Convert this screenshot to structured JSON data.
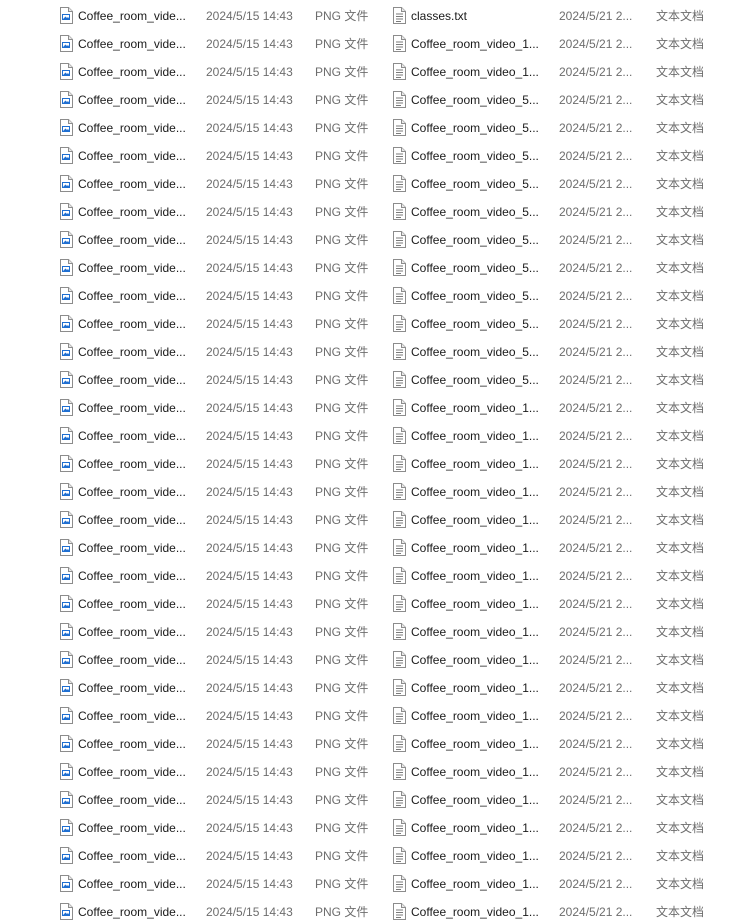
{
  "left_pane": {
    "rows": [
      {
        "name": "Coffee_room_vide...",
        "date": "2024/5/15 14:43",
        "type": "PNG 文件",
        "icon": "png-image-file-icon"
      },
      {
        "name": "Coffee_room_vide...",
        "date": "2024/5/15 14:43",
        "type": "PNG 文件",
        "icon": "png-image-file-icon"
      },
      {
        "name": "Coffee_room_vide...",
        "date": "2024/5/15 14:43",
        "type": "PNG 文件",
        "icon": "png-image-file-icon"
      },
      {
        "name": "Coffee_room_vide...",
        "date": "2024/5/15 14:43",
        "type": "PNG 文件",
        "icon": "png-image-file-icon"
      },
      {
        "name": "Coffee_room_vide...",
        "date": "2024/5/15 14:43",
        "type": "PNG 文件",
        "icon": "png-image-file-icon"
      },
      {
        "name": "Coffee_room_vide...",
        "date": "2024/5/15 14:43",
        "type": "PNG 文件",
        "icon": "png-image-file-icon"
      },
      {
        "name": "Coffee_room_vide...",
        "date": "2024/5/15 14:43",
        "type": "PNG 文件",
        "icon": "png-image-file-icon"
      },
      {
        "name": "Coffee_room_vide...",
        "date": "2024/5/15 14:43",
        "type": "PNG 文件",
        "icon": "png-image-file-icon"
      },
      {
        "name": "Coffee_room_vide...",
        "date": "2024/5/15 14:43",
        "type": "PNG 文件",
        "icon": "png-image-file-icon"
      },
      {
        "name": "Coffee_room_vide...",
        "date": "2024/5/15 14:43",
        "type": "PNG 文件",
        "icon": "png-image-file-icon"
      },
      {
        "name": "Coffee_room_vide...",
        "date": "2024/5/15 14:43",
        "type": "PNG 文件",
        "icon": "png-image-file-icon"
      },
      {
        "name": "Coffee_room_vide...",
        "date": "2024/5/15 14:43",
        "type": "PNG 文件",
        "icon": "png-image-file-icon"
      },
      {
        "name": "Coffee_room_vide...",
        "date": "2024/5/15 14:43",
        "type": "PNG 文件",
        "icon": "png-image-file-icon"
      },
      {
        "name": "Coffee_room_vide...",
        "date": "2024/5/15 14:43",
        "type": "PNG 文件",
        "icon": "png-image-file-icon"
      },
      {
        "name": "Coffee_room_vide...",
        "date": "2024/5/15 14:43",
        "type": "PNG 文件",
        "icon": "png-image-file-icon"
      },
      {
        "name": "Coffee_room_vide...",
        "date": "2024/5/15 14:43",
        "type": "PNG 文件",
        "icon": "png-image-file-icon"
      },
      {
        "name": "Coffee_room_vide...",
        "date": "2024/5/15 14:43",
        "type": "PNG 文件",
        "icon": "png-image-file-icon"
      },
      {
        "name": "Coffee_room_vide...",
        "date": "2024/5/15 14:43",
        "type": "PNG 文件",
        "icon": "png-image-file-icon"
      },
      {
        "name": "Coffee_room_vide...",
        "date": "2024/5/15 14:43",
        "type": "PNG 文件",
        "icon": "png-image-file-icon"
      },
      {
        "name": "Coffee_room_vide...",
        "date": "2024/5/15 14:43",
        "type": "PNG 文件",
        "icon": "png-image-file-icon"
      },
      {
        "name": "Coffee_room_vide...",
        "date": "2024/5/15 14:43",
        "type": "PNG 文件",
        "icon": "png-image-file-icon"
      },
      {
        "name": "Coffee_room_vide...",
        "date": "2024/5/15 14:43",
        "type": "PNG 文件",
        "icon": "png-image-file-icon"
      },
      {
        "name": "Coffee_room_vide...",
        "date": "2024/5/15 14:43",
        "type": "PNG 文件",
        "icon": "png-image-file-icon"
      },
      {
        "name": "Coffee_room_vide...",
        "date": "2024/5/15 14:43",
        "type": "PNG 文件",
        "icon": "png-image-file-icon"
      },
      {
        "name": "Coffee_room_vide...",
        "date": "2024/5/15 14:43",
        "type": "PNG 文件",
        "icon": "png-image-file-icon"
      },
      {
        "name": "Coffee_room_vide...",
        "date": "2024/5/15 14:43",
        "type": "PNG 文件",
        "icon": "png-image-file-icon"
      },
      {
        "name": "Coffee_room_vide...",
        "date": "2024/5/15 14:43",
        "type": "PNG 文件",
        "icon": "png-image-file-icon"
      },
      {
        "name": "Coffee_room_vide...",
        "date": "2024/5/15 14:43",
        "type": "PNG 文件",
        "icon": "png-image-file-icon"
      },
      {
        "name": "Coffee_room_vide...",
        "date": "2024/5/15 14:43",
        "type": "PNG 文件",
        "icon": "png-image-file-icon"
      },
      {
        "name": "Coffee_room_vide...",
        "date": "2024/5/15 14:43",
        "type": "PNG 文件",
        "icon": "png-image-file-icon"
      },
      {
        "name": "Coffee_room_vide...",
        "date": "2024/5/15 14:43",
        "type": "PNG 文件",
        "icon": "png-image-file-icon"
      },
      {
        "name": "Coffee_room_vide...",
        "date": "2024/5/15 14:43",
        "type": "PNG 文件",
        "icon": "png-image-file-icon"
      },
      {
        "name": "Coffee_room_vide...",
        "date": "2024/5/15 14:43",
        "type": "PNG 文件",
        "icon": "png-image-file-icon"
      }
    ]
  },
  "right_pane": {
    "rows": [
      {
        "name": "classes.txt",
        "date": "2024/5/21 2...",
        "type": "文本文档",
        "icon": "text-document-icon"
      },
      {
        "name": "Coffee_room_video_1...",
        "date": "2024/5/21 2...",
        "type": "文本文档",
        "icon": "text-document-icon"
      },
      {
        "name": "Coffee_room_video_1...",
        "date": "2024/5/21 2...",
        "type": "文本文档",
        "icon": "text-document-icon"
      },
      {
        "name": "Coffee_room_video_5...",
        "date": "2024/5/21 2...",
        "type": "文本文档",
        "icon": "text-document-icon"
      },
      {
        "name": "Coffee_room_video_5...",
        "date": "2024/5/21 2...",
        "type": "文本文档",
        "icon": "text-document-icon"
      },
      {
        "name": "Coffee_room_video_5...",
        "date": "2024/5/21 2...",
        "type": "文本文档",
        "icon": "text-document-icon"
      },
      {
        "name": "Coffee_room_video_5...",
        "date": "2024/5/21 2...",
        "type": "文本文档",
        "icon": "text-document-icon"
      },
      {
        "name": "Coffee_room_video_5...",
        "date": "2024/5/21 2...",
        "type": "文本文档",
        "icon": "text-document-icon"
      },
      {
        "name": "Coffee_room_video_5...",
        "date": "2024/5/21 2...",
        "type": "文本文档",
        "icon": "text-document-icon"
      },
      {
        "name": "Coffee_room_video_5...",
        "date": "2024/5/21 2...",
        "type": "文本文档",
        "icon": "text-document-icon"
      },
      {
        "name": "Coffee_room_video_5...",
        "date": "2024/5/21 2...",
        "type": "文本文档",
        "icon": "text-document-icon"
      },
      {
        "name": "Coffee_room_video_5...",
        "date": "2024/5/21 2...",
        "type": "文本文档",
        "icon": "text-document-icon"
      },
      {
        "name": "Coffee_room_video_5...",
        "date": "2024/5/21 2...",
        "type": "文本文档",
        "icon": "text-document-icon"
      },
      {
        "name": "Coffee_room_video_5...",
        "date": "2024/5/21 2...",
        "type": "文本文档",
        "icon": "text-document-icon"
      },
      {
        "name": "Coffee_room_video_1...",
        "date": "2024/5/21 2...",
        "type": "文本文档",
        "icon": "text-document-icon"
      },
      {
        "name": "Coffee_room_video_1...",
        "date": "2024/5/21 2...",
        "type": "文本文档",
        "icon": "text-document-icon"
      },
      {
        "name": "Coffee_room_video_1...",
        "date": "2024/5/21 2...",
        "type": "文本文档",
        "icon": "text-document-icon"
      },
      {
        "name": "Coffee_room_video_1...",
        "date": "2024/5/21 2...",
        "type": "文本文档",
        "icon": "text-document-icon"
      },
      {
        "name": "Coffee_room_video_1...",
        "date": "2024/5/21 2...",
        "type": "文本文档",
        "icon": "text-document-icon"
      },
      {
        "name": "Coffee_room_video_1...",
        "date": "2024/5/21 2...",
        "type": "文本文档",
        "icon": "text-document-icon"
      },
      {
        "name": "Coffee_room_video_1...",
        "date": "2024/5/21 2...",
        "type": "文本文档",
        "icon": "text-document-icon"
      },
      {
        "name": "Coffee_room_video_1...",
        "date": "2024/5/21 2...",
        "type": "文本文档",
        "icon": "text-document-icon"
      },
      {
        "name": "Coffee_room_video_1...",
        "date": "2024/5/21 2...",
        "type": "文本文档",
        "icon": "text-document-icon"
      },
      {
        "name": "Coffee_room_video_1...",
        "date": "2024/5/21 2...",
        "type": "文本文档",
        "icon": "text-document-icon"
      },
      {
        "name": "Coffee_room_video_1...",
        "date": "2024/5/21 2...",
        "type": "文本文档",
        "icon": "text-document-icon"
      },
      {
        "name": "Coffee_room_video_1...",
        "date": "2024/5/21 2...",
        "type": "文本文档",
        "icon": "text-document-icon"
      },
      {
        "name": "Coffee_room_video_1...",
        "date": "2024/5/21 2...",
        "type": "文本文档",
        "icon": "text-document-icon"
      },
      {
        "name": "Coffee_room_video_1...",
        "date": "2024/5/21 2...",
        "type": "文本文档",
        "icon": "text-document-icon"
      },
      {
        "name": "Coffee_room_video_1...",
        "date": "2024/5/21 2...",
        "type": "文本文档",
        "icon": "text-document-icon"
      },
      {
        "name": "Coffee_room_video_1...",
        "date": "2024/5/21 2...",
        "type": "文本文档",
        "icon": "text-document-icon"
      },
      {
        "name": "Coffee_room_video_1...",
        "date": "2024/5/21 2...",
        "type": "文本文档",
        "icon": "text-document-icon"
      },
      {
        "name": "Coffee_room_video_1...",
        "date": "2024/5/21 2...",
        "type": "文本文档",
        "icon": "text-document-icon"
      },
      {
        "name": "Coffee_room_video_1...",
        "date": "2024/5/21 2...",
        "type": "文本文档",
        "icon": "text-document-icon"
      }
    ]
  },
  "colors": {
    "png_icon_accent": "#1f6fd1",
    "text_icon_accent": "#7a7a7a",
    "primary_text": "#1a1a1a",
    "secondary_text": "#6d6d6d"
  }
}
